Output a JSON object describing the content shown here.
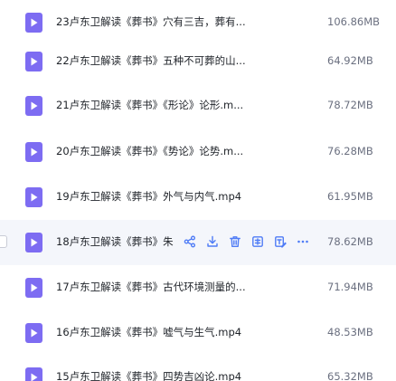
{
  "files": [
    {
      "name": "23卢东卫解读《葬书》穴有三吉，葬有...",
      "size": "106.86MB"
    },
    {
      "name": "22卢东卫解读《葬书》五种不可葬的山...",
      "size": "64.92MB"
    },
    {
      "name": "21卢东卫解读《葬书》《形论》论形.m...",
      "size": "78.72MB"
    },
    {
      "name": "20卢东卫解读《葬书》《势论》论势.m...",
      "size": "76.28MB"
    },
    {
      "name": "19卢东卫解读《葬书》外气与内气.mp4",
      "size": "61.95MB"
    },
    {
      "name": "18卢东卫解读《葬书》朱",
      "size": "78.62MB"
    },
    {
      "name": "17卢东卫解读《葬书》古代环境测量的...",
      "size": "71.94MB"
    },
    {
      "name": "16卢东卫解读《葬书》嘘气与生气.mp4",
      "size": "48.53MB"
    },
    {
      "name": "15卢东卫解读《葬书》四势吉凶论.mp4",
      "size": "65.32MB"
    }
  ],
  "hovered_row_actions": [
    "share-icon",
    "download-icon",
    "delete-icon",
    "move-icon",
    "rename-icon",
    "more-icon"
  ],
  "colors": {
    "video_icon": "#7d6cf2",
    "action_icon": "#4f7cf6",
    "hover_bg": "#f4f6fb"
  }
}
